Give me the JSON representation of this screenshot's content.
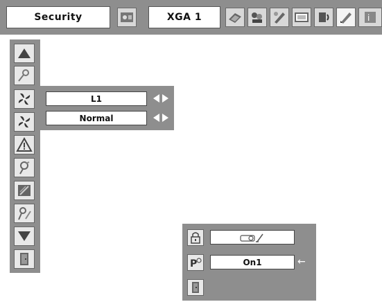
{
  "menu": {
    "title": "Security",
    "input_source": "XGA 1",
    "tab_icons": [
      "image-adjust-icon",
      "computer-icon",
      "image-select-icon",
      "setting-icon",
      "screen-icon",
      "sound-icon",
      "security-icon",
      "info-icon"
    ]
  },
  "sidebar": {
    "items": [
      "scroll-up-icon",
      "pin-code-lock-icon",
      "fan-control-icon",
      "fan-icon",
      "warning-icon",
      "pin-code-change-icon",
      "logo-lock-icon",
      "logo-pin-change-icon",
      "scroll-down-icon",
      "exit-icon"
    ]
  },
  "settings": {
    "row1_value": "L1",
    "row2_value": "Normal"
  },
  "lock_popup": {
    "row1_icon": "projector-key-icon",
    "row2_value": "On1",
    "row2_marker": "←"
  },
  "colors": {
    "panel": "#8e8e8e",
    "field": "#ffffff",
    "icon_bg": "#e8e8e8"
  }
}
